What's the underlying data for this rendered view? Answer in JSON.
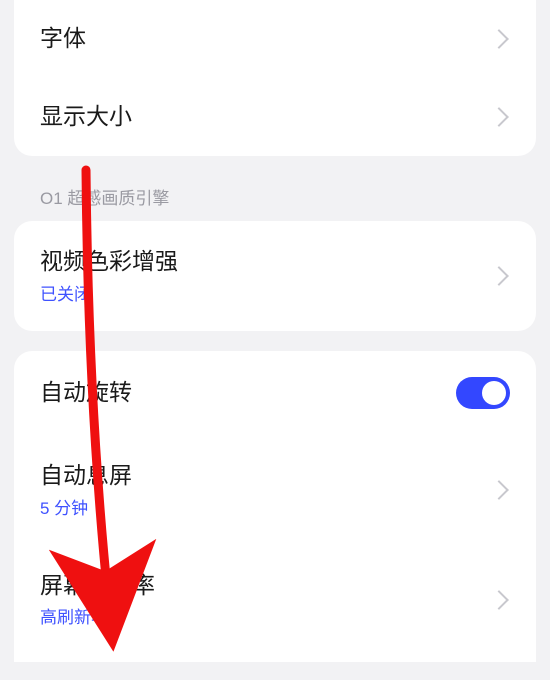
{
  "group1": {
    "font": {
      "title": "字体"
    },
    "displaySize": {
      "title": "显示大小"
    }
  },
  "sectionHeader": "O1 超感画质引擎",
  "group2": {
    "videoEnhance": {
      "title": "视频色彩增强",
      "subtitle": "已关闭"
    }
  },
  "group3": {
    "autoRotate": {
      "title": "自动旋转",
      "enabled": true
    },
    "autoSleep": {
      "title": "自动息屏",
      "subtitle": "5 分钟"
    },
    "refreshRate": {
      "title": "屏幕刷新率",
      "subtitle": "高刷新率"
    }
  },
  "annotation": {
    "type": "arrow",
    "color": "#ef1010"
  }
}
